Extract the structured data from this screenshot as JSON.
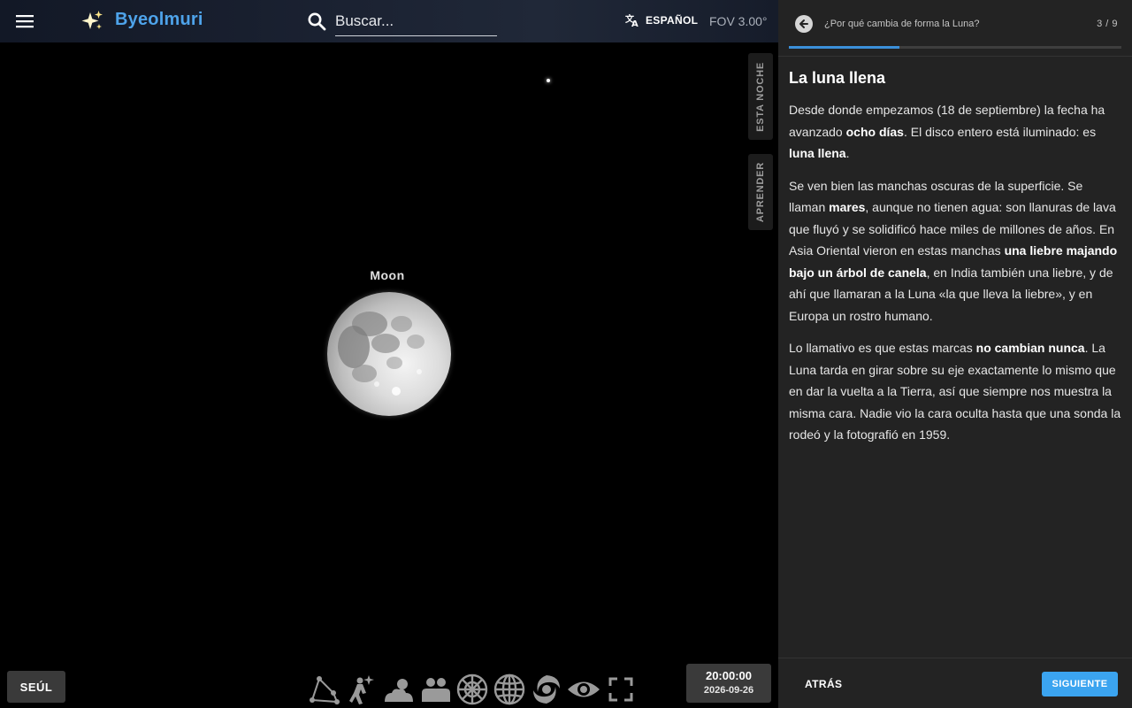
{
  "app": {
    "title": "Byeolmuri",
    "logo_icon": "sparkles-icon",
    "menu_icon": "hamburger-menu-icon"
  },
  "search": {
    "placeholder": "Buscar...",
    "icon": "search-icon"
  },
  "language": {
    "label": "ESPAÑOL",
    "icon": "translate-icon"
  },
  "fov": "FOV 3.00°",
  "side_tabs": {
    "tonight": "ESTA NOCHE",
    "learn": "APRENDER"
  },
  "sky": {
    "object_label": "Moon"
  },
  "location": "SEÚL",
  "toolbar": {
    "tools": [
      {
        "name": "constellation-lines-icon"
      },
      {
        "name": "constellation-figures-icon"
      },
      {
        "name": "atmosphere-icon"
      },
      {
        "name": "landscape-icon"
      },
      {
        "name": "azimuthal-grid-icon"
      },
      {
        "name": "equatorial-grid-icon"
      },
      {
        "name": "deep-sky-objects-icon"
      },
      {
        "name": "night-mode-eye-icon"
      },
      {
        "name": "fullscreen-icon"
      }
    ]
  },
  "clock": {
    "time": "20:00:00",
    "date": "2026-09-26"
  },
  "tour": {
    "title": "¿Por qué cambia de forma la Luna?",
    "step": "3 / 9",
    "progress_fraction": 0.333,
    "heading": "La luna llena",
    "paragraphs": [
      [
        {
          "t": "Desde donde empezamos (18 de septiembre) la fecha ha avanzado "
        },
        {
          "t": "ocho días",
          "b": true
        },
        {
          "t": ". El disco entero está iluminado: es "
        },
        {
          "t": "luna llena",
          "b": true
        },
        {
          "t": "."
        }
      ],
      [
        {
          "t": "Se ven bien las manchas oscuras de la superficie. Se llaman "
        },
        {
          "t": "mares",
          "b": true
        },
        {
          "t": ", aunque no tienen agua: son llanuras de lava que fluyó y se solidificó hace miles de millones de años. En Asia Oriental vieron en estas manchas "
        },
        {
          "t": "una liebre majando bajo un árbol de canela",
          "b": true
        },
        {
          "t": ", en India también una liebre, y de ahí que llamaran a la Luna «la que lleva la liebre», y en Europa un rostro humano."
        }
      ],
      [
        {
          "t": "Lo llamativo es que estas marcas "
        },
        {
          "t": "no cambian nunca",
          "b": true
        },
        {
          "t": ". La Luna tarda en girar sobre su eje exactamente lo mismo que en dar la vuelta a la Tierra, así que siempre nos muestra la misma cara. Nadie vio la cara oculta hasta que una sonda la rodeó y la fotografió en 1959."
        }
      ]
    ],
    "prev_label": "ATRÁS",
    "next_label": "SIGUIENTE"
  },
  "colors": {
    "accent": "#3ba4f0",
    "title_blue": "#4ea3ea",
    "panel_bg": "#232323"
  }
}
